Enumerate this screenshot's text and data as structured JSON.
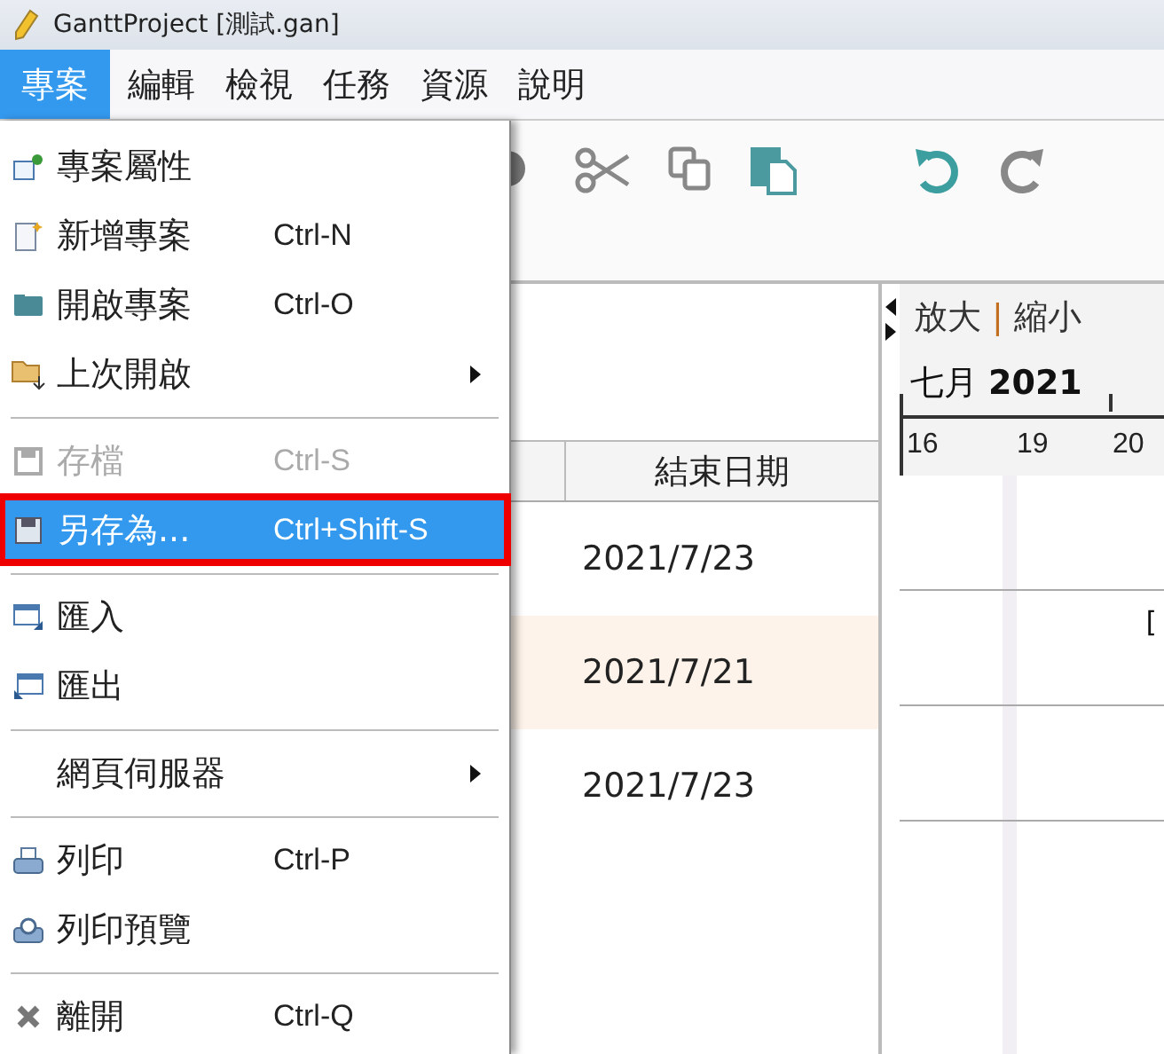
{
  "window": {
    "title": "GanttProject [測試.gan]"
  },
  "menubar": [
    {
      "label": "專案",
      "selected": true
    },
    {
      "label": "編輯",
      "selected": false
    },
    {
      "label": "檢視",
      "selected": false
    },
    {
      "label": "任務",
      "selected": false
    },
    {
      "label": "資源",
      "selected": false
    },
    {
      "label": "說明",
      "selected": false
    }
  ],
  "file_menu": {
    "items": [
      {
        "kind": "item",
        "label": "專案屬性",
        "disabled": false,
        "selected": false,
        "submenu": false
      },
      {
        "kind": "item",
        "label": "新增專案",
        "shortcut": "Ctrl-N",
        "disabled": false,
        "selected": false,
        "submenu": false
      },
      {
        "kind": "item",
        "label": "開啟專案",
        "shortcut": "Ctrl-O",
        "disabled": false,
        "selected": false,
        "submenu": false
      },
      {
        "kind": "item",
        "label": "上次開啟",
        "disabled": false,
        "selected": false,
        "submenu": true
      },
      {
        "kind": "separator"
      },
      {
        "kind": "item",
        "label": "存檔",
        "shortcut": "Ctrl-S",
        "disabled": true,
        "selected": false,
        "submenu": false
      },
      {
        "kind": "item",
        "label": "另存為...",
        "shortcut": "Ctrl+Shift-S",
        "disabled": false,
        "selected": true,
        "submenu": false
      },
      {
        "kind": "separator"
      },
      {
        "kind": "item",
        "label": "匯入",
        "disabled": false,
        "selected": false,
        "submenu": false
      },
      {
        "kind": "item",
        "label": "匯出",
        "disabled": false,
        "selected": false,
        "submenu": false
      },
      {
        "kind": "separator"
      },
      {
        "kind": "item",
        "label": "網頁伺服器",
        "disabled": false,
        "selected": false,
        "submenu": true
      },
      {
        "kind": "separator"
      },
      {
        "kind": "item",
        "label": "列印",
        "shortcut": "Ctrl-P",
        "disabled": false,
        "selected": false,
        "submenu": false
      },
      {
        "kind": "item",
        "label": "列印預覽",
        "disabled": false,
        "selected": false,
        "submenu": false
      },
      {
        "kind": "separator"
      },
      {
        "kind": "item",
        "label": "離開",
        "shortcut": "Ctrl-Q",
        "disabled": false,
        "selected": false,
        "submenu": false
      }
    ]
  },
  "table": {
    "columns": [
      "結束日期"
    ],
    "rows": [
      {
        "end_date": "2021/7/23",
        "highlighted": false
      },
      {
        "end_date": "2021/7/21",
        "highlighted": true
      },
      {
        "end_date": "2021/7/23",
        "highlighted": false
      }
    ]
  },
  "gantt": {
    "zoom_in": "放大",
    "separator": "|",
    "zoom_out": "縮小",
    "month": "七月",
    "year": "2021",
    "days": [
      "16",
      "19",
      "20"
    ],
    "rows": [
      {
        "kind": "empty"
      },
      {
        "kind": "marker",
        "text": "["
      },
      {
        "kind": "empty"
      }
    ]
  }
}
